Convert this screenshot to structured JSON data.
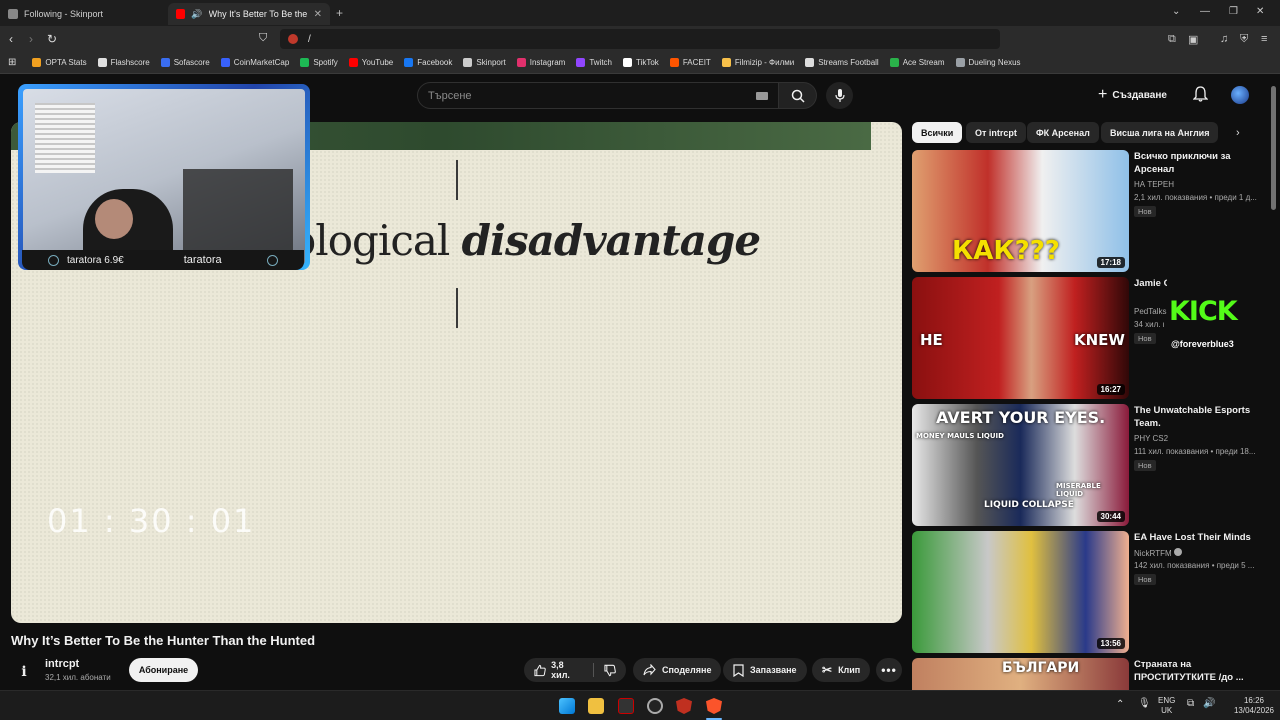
{
  "browser": {
    "tabs": [
      {
        "label": "Following - Skinport",
        "active": false
      },
      {
        "label": "Why It's Better To Be the Hun",
        "active": true
      }
    ],
    "address": "/",
    "bookmarks": [
      {
        "label": "OPTA Stats",
        "color": "#f0a020"
      },
      {
        "label": "Flashscore",
        "color": "#e0e0e0"
      },
      {
        "label": "Sofascore",
        "color": "#3a6df0"
      },
      {
        "label": "CoinMarketCap",
        "color": "#3861fb"
      },
      {
        "label": "Spotify",
        "color": "#1db954"
      },
      {
        "label": "YouTube",
        "color": "#ff0000"
      },
      {
        "label": "Facebook",
        "color": "#1877f2"
      },
      {
        "label": "Skinport",
        "color": "#cccccc"
      },
      {
        "label": "Instagram",
        "color": "#e1306c"
      },
      {
        "label": "Twitch",
        "color": "#9146ff"
      },
      {
        "label": "TikTok",
        "color": "#ffffff"
      },
      {
        "label": "FACEIT",
        "color": "#ff5500"
      },
      {
        "label": "Filmizip - Филми",
        "color": "#f7c04a"
      },
      {
        "label": "Streams Football",
        "color": "#dddddd"
      },
      {
        "label": "Ace Stream",
        "color": "#2ab24a"
      },
      {
        "label": "Dueling Nexus",
        "color": "#9aa0a6"
      }
    ]
  },
  "youtube": {
    "search_placeholder": "Търсене",
    "create_label": "Създаване",
    "video": {
      "phrase_start": "ological ",
      "phrase_italic": "disadvantage",
      "timer": "01 : 30 : 01",
      "title": "Why It’s Better To Be the Hunter Than the Hunted",
      "channel": "intrcpt",
      "channel_letter": "i",
      "subscribers": "32,1 хил. абонати",
      "subscribe_label": "Абониране",
      "likes": "3,8 хил.",
      "share_label": "Споделяне",
      "save_label": "Запазване",
      "clip_label": "Клип"
    },
    "webcam": {
      "coin_text": "taratora 6.9€",
      "name": "taratora"
    },
    "chips": [
      "Всички",
      "От intrcpt",
      "ФК Арсенал",
      "Висша лига на Англия"
    ],
    "recommendations": [
      {
        "title": "Всичко приключи за Арсенал",
        "channel": "НА ТЕРЕН",
        "meta": "2,1 хил. показвания • преди 1 д...",
        "badge": "Нов",
        "duration": "17:18",
        "thumb_text": "КАК???"
      },
      {
        "title": "Jamie C... ...s About S...",
        "channel": "PedTalks",
        "meta": "34 хил. п...",
        "badge": "Нов",
        "duration": "16:27",
        "thumb_text_left": "HE",
        "thumb_text_right": "KNEW"
      },
      {
        "title": "The Unwatchable Esports Team.",
        "channel": "PHY CS2",
        "meta": "111 хил. показвания • преди 18...",
        "badge": "Нов",
        "duration": "30:44",
        "thumb_text": "AVERT YOUR EYES.",
        "thumb_sub1": "MONEY MAULS LIQUID",
        "thumb_sub2": "MISERABLE LIQUID",
        "thumb_sub3": "LIQUID COLLAPSE"
      },
      {
        "title": "EA Have Lost Their Minds",
        "channel": "NickRTFM",
        "meta": "142 хил. показвания • преди 5 ...",
        "badge": "Нов",
        "duration": "13:56"
      },
      {
        "title": "Страната на ПРОСТИТУТКИТЕ /до ...",
        "thumb_text": "БЪЛГАРИ"
      }
    ],
    "kick": {
      "logo": "KICK",
      "handle": "@foreverblue3"
    }
  },
  "taskbar": {
    "lang1": "ENG",
    "lang2": "UK",
    "time": "16:26",
    "date": "13/04/2026"
  }
}
